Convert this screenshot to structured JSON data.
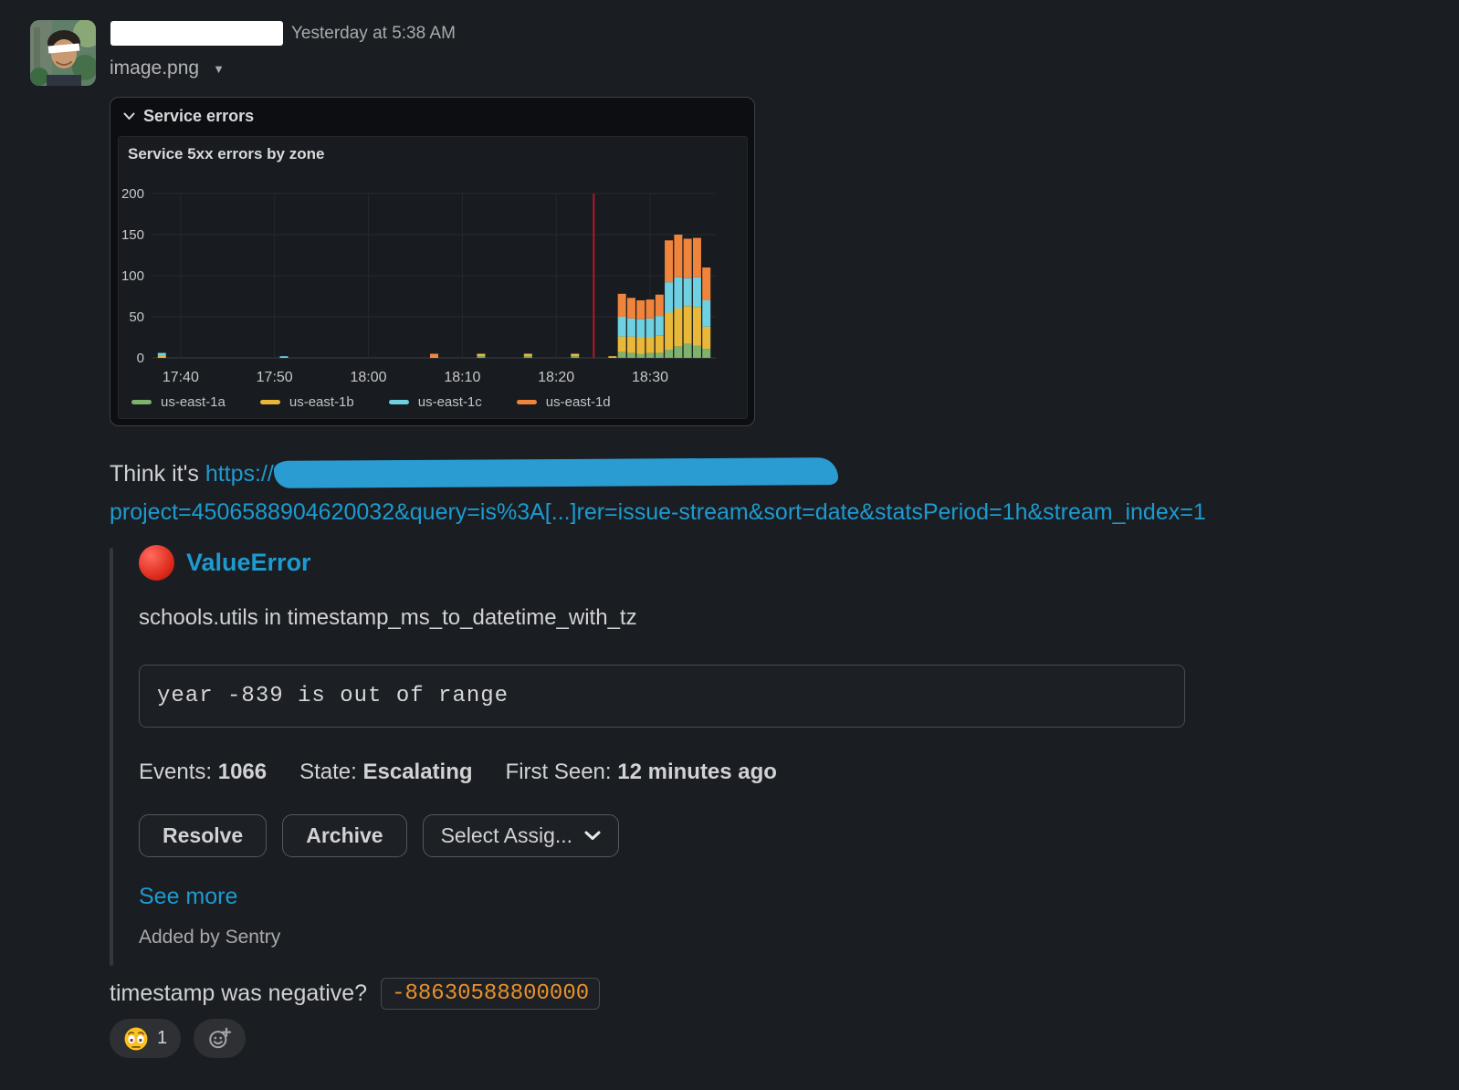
{
  "header": {
    "timestamp": "Yesterday at 5:38 AM",
    "file_name": "image.png",
    "file_caret": "▼"
  },
  "chart_data": {
    "type": "bar",
    "stacked": true,
    "row_title": "Service errors",
    "title": "Service 5xx errors by zone",
    "ylim": [
      0,
      200
    ],
    "yticks": [
      0,
      50,
      100,
      150,
      200
    ],
    "xtick_labels": [
      "17:40",
      "17:50",
      "18:00",
      "18:10",
      "18:20",
      "18:30"
    ],
    "x_start": "17:37",
    "x_end": "18:37",
    "annotation_x": "18:24",
    "annotation_color": "#c4162a",
    "grid": true,
    "legend_position": "bottom",
    "bar_times": [
      "17:38",
      "17:51",
      "18:07",
      "18:12",
      "18:17",
      "18:22",
      "18:26",
      "18:27",
      "18:28",
      "18:29",
      "18:30",
      "18:31",
      "18:32",
      "18:33",
      "18:34",
      "18:35",
      "18:36"
    ],
    "series": [
      {
        "name": "us-east-1a",
        "color": "#7eb26d",
        "values": [
          0,
          0,
          0,
          2,
          2,
          2,
          0,
          7,
          6,
          5,
          6,
          6,
          10,
          14,
          17,
          15,
          11
        ]
      },
      {
        "name": "us-east-1b",
        "color": "#eab839",
        "values": [
          3,
          0,
          1,
          3,
          3,
          3,
          2,
          19,
          20,
          20,
          19,
          21,
          45,
          46,
          46,
          47,
          27
        ]
      },
      {
        "name": "us-east-1c",
        "color": "#6ed0e0",
        "values": [
          3,
          2,
          0,
          0,
          0,
          0,
          0,
          24,
          22,
          22,
          23,
          24,
          37,
          38,
          34,
          36,
          32
        ]
      },
      {
        "name": "us-east-1d",
        "color": "#ef843c",
        "values": [
          0,
          0,
          4,
          0,
          0,
          0,
          0,
          28,
          25,
          23,
          23,
          26,
          51,
          52,
          48,
          48,
          40
        ]
      }
    ]
  },
  "message": {
    "intro": "Think it's ",
    "link_prefix": "https://",
    "link_line2": "project=4506588904620032&query=is%3A[...]rer=issue-stream&sort=date&statsPeriod=1h&stream_index=1",
    "question": "timestamp was negative?",
    "inline_code": "-88630588800000"
  },
  "sentry": {
    "issue_title": "ValueError",
    "issue_location": "schools.utils in timestamp_ms_to_datetime_with_tz",
    "error_message": "year -839 is out of range",
    "stats": [
      {
        "label": "Events: ",
        "value": "1066"
      },
      {
        "label": "State: ",
        "value": "Escalating"
      },
      {
        "label": "First Seen: ",
        "value": "12 minutes ago"
      }
    ],
    "buttons": [
      "Resolve",
      "Archive"
    ],
    "assign_button": "Select Assig...",
    "see_more": "See more",
    "footer": "Added by Sentry"
  },
  "reactions": {
    "items": [
      {
        "emoji": "flushed-face",
        "count": "1"
      }
    ]
  }
}
